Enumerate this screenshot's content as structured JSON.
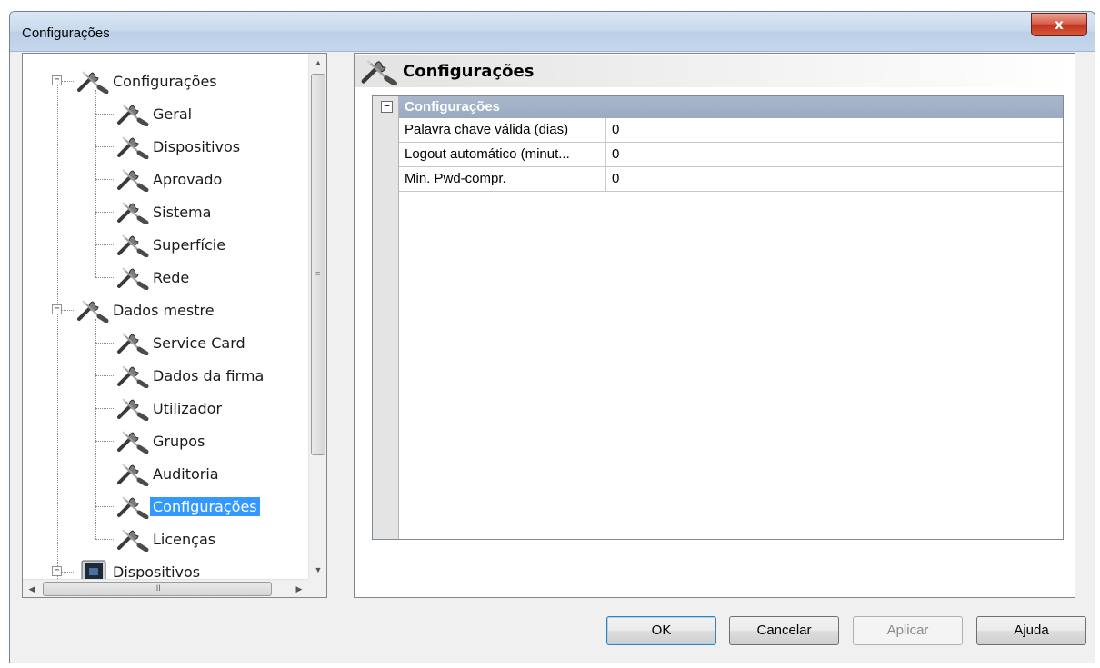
{
  "window": {
    "title": "Configurações",
    "close_glyph": "x"
  },
  "tree": {
    "nodes": [
      {
        "label": "Configurações",
        "level": 0,
        "expander": "−",
        "icon": "tools-icon"
      },
      {
        "label": "Geral",
        "level": 1,
        "icon": "tools-icon"
      },
      {
        "label": "Dispositivos",
        "level": 1,
        "icon": "tools-icon"
      },
      {
        "label": "Aprovado",
        "level": 1,
        "icon": "tools-icon"
      },
      {
        "label": "Sistema",
        "level": 1,
        "icon": "tools-icon"
      },
      {
        "label": "Superfície",
        "level": 1,
        "icon": "tools-icon"
      },
      {
        "label": "Rede",
        "level": 1,
        "icon": "tools-icon"
      },
      {
        "label": "Dados mestre",
        "level": 0,
        "expander": "−",
        "icon": "tools-icon"
      },
      {
        "label": "Service Card",
        "level": 1,
        "icon": "tools-icon"
      },
      {
        "label": "Dados da firma",
        "level": 1,
        "icon": "tools-icon"
      },
      {
        "label": "Utilizador",
        "level": 1,
        "icon": "tools-icon"
      },
      {
        "label": "Grupos",
        "level": 1,
        "icon": "tools-icon"
      },
      {
        "label": "Auditoria",
        "level": 1,
        "icon": "tools-icon"
      },
      {
        "label": "Configurações",
        "level": 1,
        "icon": "tools-icon",
        "selected": true
      },
      {
        "label": "Licenças",
        "level": 1,
        "icon": "tools-icon"
      },
      {
        "label": "Dispositivos",
        "level": 0,
        "expander": "−",
        "icon": "device-icon"
      }
    ],
    "scroll_grip": "≡",
    "hscroll_grip": "III"
  },
  "content": {
    "title": "Configurações",
    "title_icon": "tools-icon",
    "category": {
      "expander": "−",
      "label": "Configurações"
    },
    "rows": [
      {
        "name": "Palavra chave válida (dias)",
        "value": "0"
      },
      {
        "name": "Logout automático (minut...",
        "value": "0"
      },
      {
        "name": "Min. Pwd-compr.",
        "value": "0"
      }
    ]
  },
  "buttons": {
    "ok": "OK",
    "cancel": "Cancelar",
    "apply": "Aplicar",
    "help": "Ajuda"
  }
}
